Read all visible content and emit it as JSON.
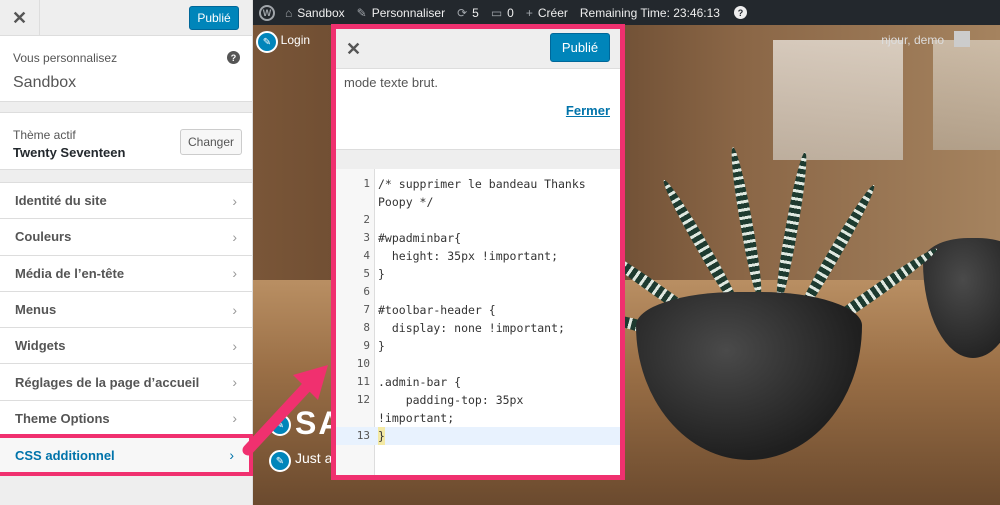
{
  "sidebar": {
    "publish_label": "Publié",
    "info_small": "Vous personnalisez",
    "info_big": "Sandbox",
    "theme_small": "Thème actif",
    "theme_big": "Twenty Seventeen",
    "change_label": "Changer",
    "items": [
      {
        "label": "Identité du site"
      },
      {
        "label": "Couleurs"
      },
      {
        "label": "Média de l’en-tête"
      },
      {
        "label": "Menus"
      },
      {
        "label": "Widgets"
      },
      {
        "label": "Réglages de la page d’accueil"
      },
      {
        "label": "Theme Options"
      },
      {
        "label": "CSS additionnel"
      }
    ]
  },
  "admin_bar": {
    "site": "Sandbox",
    "customize": "Personnaliser",
    "updates": "5",
    "comments": "0",
    "create": "Créer",
    "remaining": "Remaining Time: 23:46:13",
    "greeting": "njour, demo",
    "admin_login": "min Login"
  },
  "preview": {
    "site_title": "SA",
    "site_desc": "Just a"
  },
  "popup": {
    "publish_label": "Publié",
    "text": "mode texte brut.",
    "fermer": "Fermer",
    "code_lines": [
      {
        "n": "1",
        "t": "/* supprimer le bandeau Thanks"
      },
      {
        "n": "",
        "t": "Poopy */"
      },
      {
        "n": "2",
        "t": ""
      },
      {
        "n": "3",
        "t": "#wpadminbar{"
      },
      {
        "n": "4",
        "t": "  height: 35px !important;"
      },
      {
        "n": "5",
        "t": "}"
      },
      {
        "n": "6",
        "t": ""
      },
      {
        "n": "7",
        "t": "#toolbar-header {"
      },
      {
        "n": "8",
        "t": "  display: none !important;"
      },
      {
        "n": "9",
        "t": "}"
      },
      {
        "n": "10",
        "t": ""
      },
      {
        "n": "11",
        "t": ".admin-bar {"
      },
      {
        "n": "12",
        "t": "    padding-top: 35px"
      },
      {
        "n": "",
        "t": "!important;"
      },
      {
        "n": "13",
        "t": "}"
      }
    ]
  },
  "colors": {
    "accent": "#0085ba",
    "highlight": "#f0306f",
    "admin_bar": "#23282d"
  }
}
